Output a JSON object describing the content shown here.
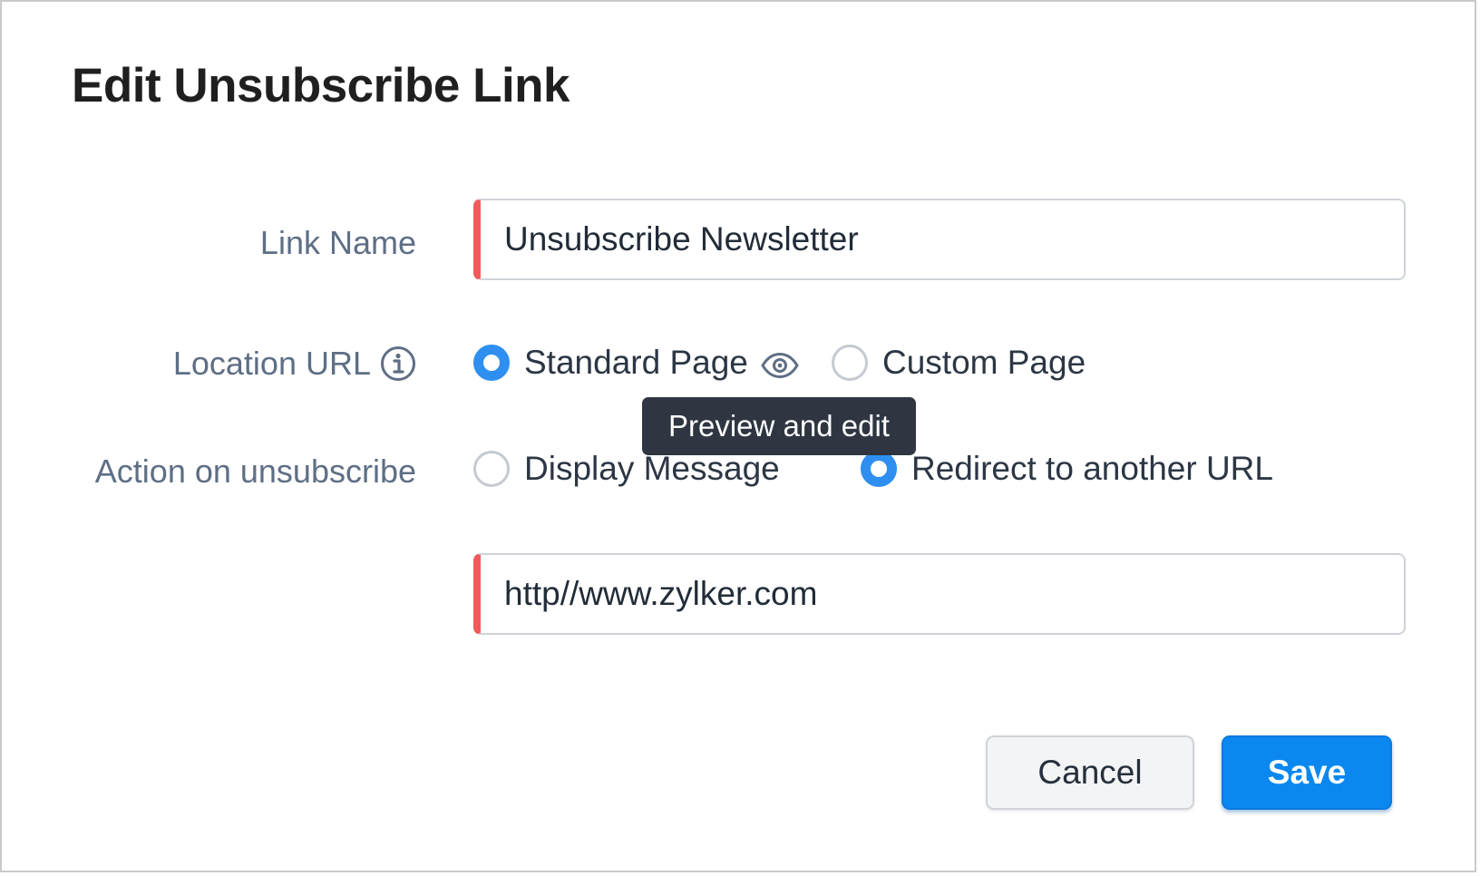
{
  "dialog": {
    "title": "Edit Unsubscribe Link"
  },
  "fields": {
    "link_name": {
      "label": "Link Name",
      "value": "Unsubscribe Newsletter"
    },
    "location_url": {
      "label": "Location URL",
      "info_icon": "info-icon",
      "options": [
        {
          "label": "Standard Page",
          "checked": true,
          "icon": "eye-icon"
        },
        {
          "label": "Custom Page",
          "checked": false
        }
      ],
      "tooltip": "Preview and edit"
    },
    "action_on_unsubscribe": {
      "label": "Action on unsubscribe",
      "options": [
        {
          "label": "Display Message",
          "checked": false
        },
        {
          "label": "Redirect to another URL",
          "checked": true
        }
      ]
    },
    "redirect_url": {
      "value": "http//www.zylker.com"
    }
  },
  "buttons": {
    "cancel": "Cancel",
    "save": "Save"
  },
  "colors": {
    "accent": "#0a88f0",
    "radio_checked": "#2e8ff0",
    "required_marker": "#f05a5a",
    "label_text": "#5e6e85",
    "tooltip_bg": "#2f3642"
  }
}
